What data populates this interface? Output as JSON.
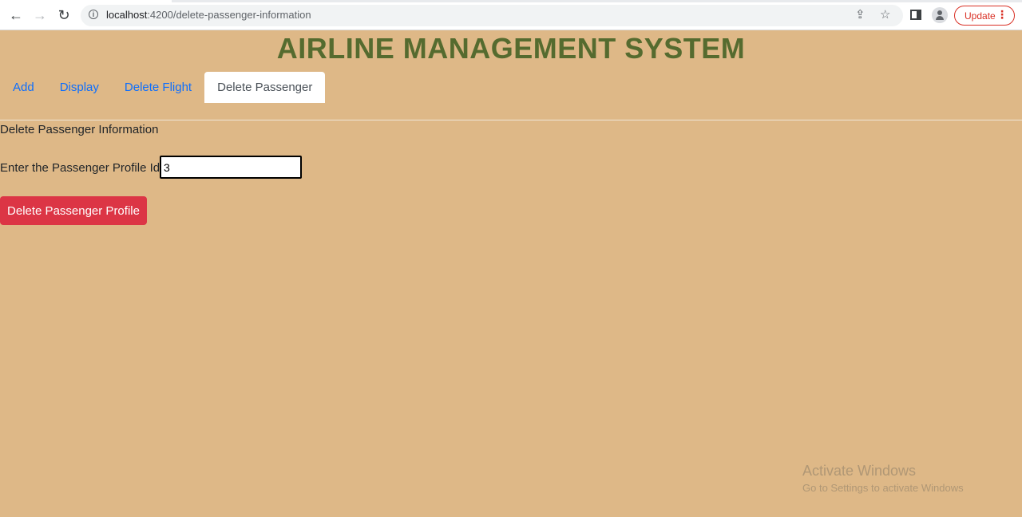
{
  "browser": {
    "url_host": "localhost",
    "url_path": ":4200/delete-passenger-information",
    "update_label": "Update"
  },
  "page": {
    "title": "AIRLINE MANAGEMENT SYSTEM",
    "tabs": [
      {
        "label": "Add",
        "active": false
      },
      {
        "label": "Display",
        "active": false
      },
      {
        "label": "Delete Flight",
        "active": false
      },
      {
        "label": "Delete Passenger",
        "active": true
      }
    ],
    "section_heading": "Delete Passenger Information",
    "field_label": "Enter the Passenger Profile Id:",
    "field_value": "3",
    "delete_button_label": "Delete Passenger Profile"
  },
  "watermark": {
    "line1": "Activate Windows",
    "line2": "Go to Settings to activate Windows"
  },
  "colors": {
    "background": "#deb887",
    "title": "#556b2f",
    "link": "#0d6efd",
    "danger": "#dc3545"
  }
}
